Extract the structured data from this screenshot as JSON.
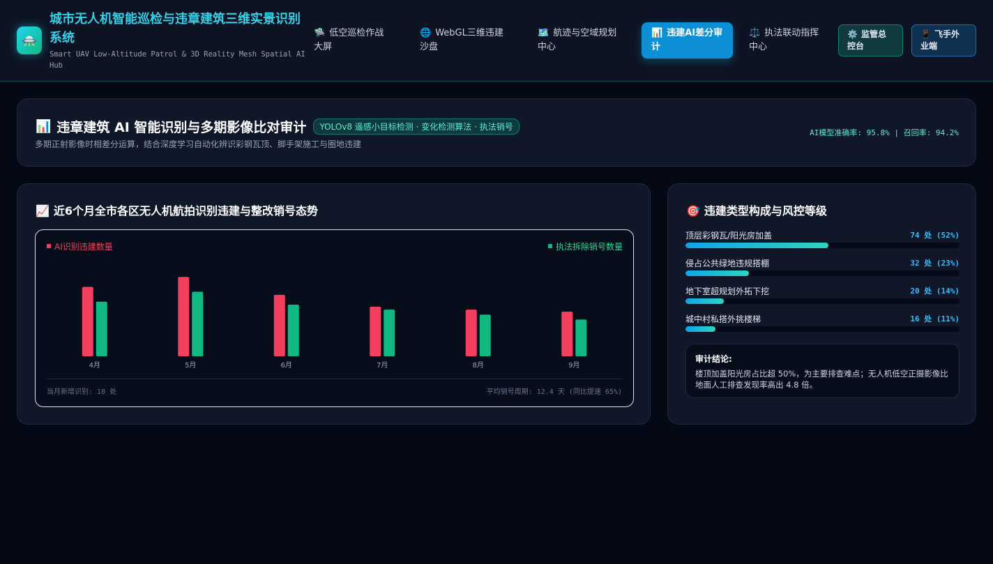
{
  "header": {
    "title": "城市无人机智能巡检与违章建筑三维实景识别系统",
    "subtitle": "Smart UAV Low-Altitude Patrol & 3D Reality Mesh Spatial AI Hub",
    "logo_icon": "ufo-icon",
    "tabs": [
      {
        "icon": "🛸",
        "label": "低空巡检作战大屏"
      },
      {
        "icon": "🌐",
        "label": "WebGL三维违建沙盘"
      },
      {
        "icon": "🗺️",
        "label": "航迹与空域规划中心"
      },
      {
        "icon": "📊",
        "label": "违建AI差分审计",
        "active": true
      },
      {
        "icon": "⚖️",
        "label": "执法联动指挥中心"
      }
    ],
    "buttons": [
      {
        "icon": "⚙️",
        "label": "监管总控台"
      },
      {
        "icon": "📱",
        "label": "飞手外业端"
      }
    ]
  },
  "banner": {
    "icon": "📊",
    "title": "违章建筑 AI 智能识别与多期影像比对审计",
    "tag": "YOLOv8 遥感小目标检测 · 变化检测算法 · 执法销号",
    "description": "多期正射影像时相差分运算，结合深度学习自动化辨识彩钢瓦顶、脚手架施工与圈地违建",
    "metric": "AI模型准确率: 95.8% | 召回率: 94.2%"
  },
  "trend": {
    "icon": "📈",
    "title": "近6个月全市各区无人机航拍识别违建与整改销号态势",
    "footer_left": "当月新增识别: 18 处",
    "footer_right": "平均销号周期: 12.4 天 (同比提速 65%)"
  },
  "chart_data": {
    "type": "bar",
    "categories": [
      "4月",
      "5月",
      "6月",
      "7月",
      "8月",
      "9月"
    ],
    "series": [
      {
        "name": "AI识别违建数量",
        "color": "#f43f5e",
        "values": [
          70,
          80,
          62,
          50,
          47,
          45
        ]
      },
      {
        "name": "执法拆除销号数量",
        "color": "#10b981",
        "values": [
          55,
          65,
          52,
          47,
          42,
          37
        ]
      }
    ],
    "ylim": [
      0,
      90
    ],
    "legend": "top"
  },
  "types": {
    "icon": "🎯",
    "title": "违建类型构成与风控等级",
    "items": [
      {
        "name": "顶层彩钢瓦/阳光房加盖",
        "value": "74 处 (52%)",
        "fraction": 0.52
      },
      {
        "name": "侵占公共绿地违规搭棚",
        "value": "32 处 (23%)",
        "fraction": 0.23
      },
      {
        "name": "地下室超规划外拓下挖",
        "value": "20 处 (14%)",
        "fraction": 0.14
      },
      {
        "name": "城中村私搭外挑楼梯",
        "value": "16 处 (11%)",
        "fraction": 0.11
      }
    ],
    "conclusion_title": "审计结论:",
    "conclusion_text": "楼顶加盖阳光房占比超 50%，为主要排查难点；无人机低空正摄影像比地面人工排查发现率高出 4.8 倍。"
  }
}
